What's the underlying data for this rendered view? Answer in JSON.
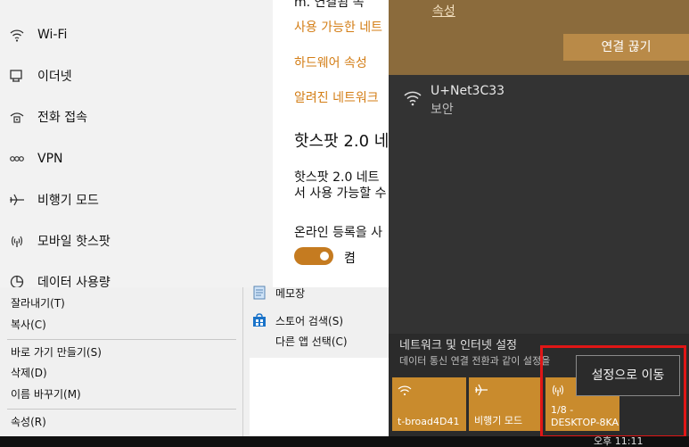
{
  "settings": {
    "nav_items": [
      {
        "label": "Wi-Fi",
        "icon": "wifi-icon"
      },
      {
        "label": "이더넷",
        "icon": "ethernet-icon"
      },
      {
        "label": "전화 접속",
        "icon": "dialup-icon"
      },
      {
        "label": "VPN",
        "icon": "vpn-icon"
      },
      {
        "label": "비행기 모드",
        "icon": "airplane-icon"
      },
      {
        "label": "모바일 핫스팟",
        "icon": "hotspot-icon"
      },
      {
        "label": "데이터 사용량",
        "icon": "data-usage-icon"
      }
    ],
    "content": {
      "top_partial": "m. 연결됨 속",
      "link_available": "사용 가능한 네트",
      "link_hardware": "하드웨어 속성",
      "link_known": "알려진 네트워크",
      "hotspot_heading": "핫스팟 2.0 네",
      "hotspot_desc_1": "핫스팟 2.0 네트",
      "hotspot_desc_2": "서 사용 가능할 수",
      "online_signup": "온라인 등록을 사",
      "toggle_state": "켬"
    }
  },
  "context_menu": {
    "cut": "잘라내기(T)",
    "copy": "복사(C)",
    "create_shortcut": "바로 가기 만들기(S)",
    "delete": "삭제(D)",
    "rename": "이름 바꾸기(M)",
    "properties": "속성(R)"
  },
  "start_list": {
    "notepad": "메모장",
    "store_search": "스토어 검색(S)",
    "other_app": "다른 앱 선택(C)"
  },
  "flyout": {
    "properties_link": "속성",
    "disconnect_button": "연결 끊기",
    "network_name": "U+Net3C33",
    "network_status": "보안",
    "settings_title": "네트워크 및 인터넷 설정",
    "settings_subtitle": "데이터 통신 연결 전환과 같이 설정을",
    "tiles": [
      {
        "label": "t-broad4D41",
        "icon": "wifi-icon"
      },
      {
        "label": "비행기 모드",
        "icon": "airplane-icon"
      },
      {
        "label_line1": "1/8 -",
        "label_line2": "DESKTOP-8KA",
        "icon": "hotspot-icon"
      }
    ],
    "tooltip": "설정으로 이동"
  },
  "taskbar": {
    "clock": "오후 11:11"
  },
  "colors": {
    "accent": "#c98b2d",
    "link": "#d37d15",
    "highlight": "#e01616"
  }
}
